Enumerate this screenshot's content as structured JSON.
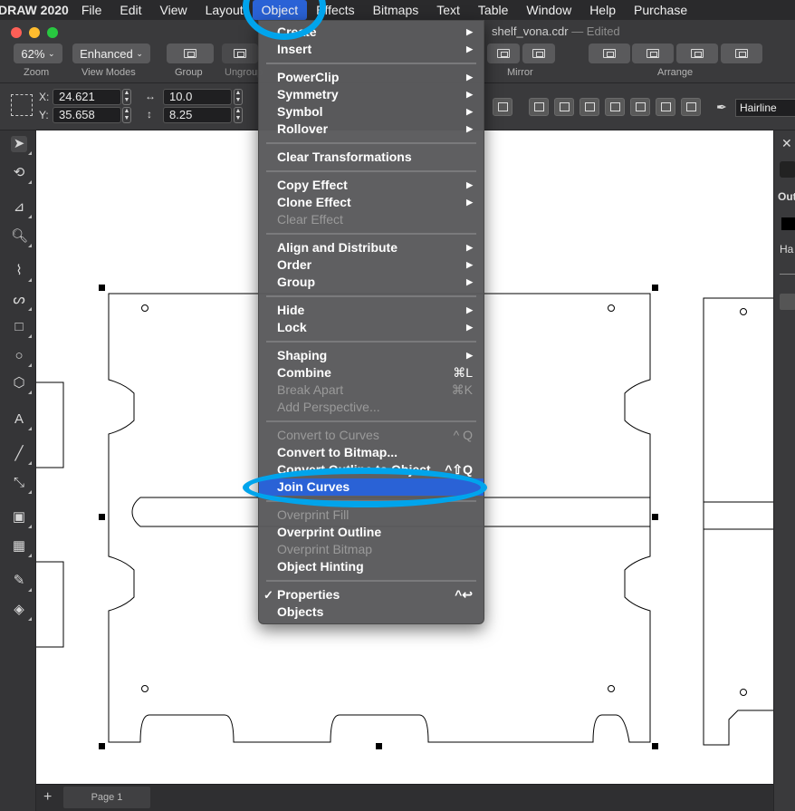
{
  "menubar": {
    "app_title": "DRAW 2020",
    "items": [
      "File",
      "Edit",
      "View",
      "Layout",
      "Object",
      "Effects",
      "Bitmaps",
      "Text",
      "Table",
      "Window",
      "Help",
      "Purchase"
    ],
    "active": "Object"
  },
  "window": {
    "filename": "shelf_vona.cdr",
    "status": "— Edited"
  },
  "toolbar": {
    "zoom_value": "62%",
    "zoom_label": "Zoom",
    "view_mode_value": "Enhanced",
    "view_modes_label": "View Modes",
    "group_label": "Group",
    "ungroup_label": "Ungroup",
    "mirror_label": "Mirror",
    "arrange_label": "Arrange"
  },
  "propertybar": {
    "x_label": "X:",
    "x_value": "24.621",
    "y_label": "Y:",
    "y_value": "35.658",
    "w_value": "10.0",
    "h_value": "8.25",
    "outline_width": "Hairline"
  },
  "docker": {
    "section_label": "Out",
    "field_value": "Ha"
  },
  "status": {
    "add_page": "+",
    "page_tab": "Page 1"
  },
  "object_menu": {
    "items": [
      {
        "label": "Create",
        "submenu": true,
        "disabled": false
      },
      {
        "label": "Insert",
        "submenu": true,
        "disabled": false
      },
      {
        "label": "PowerClip",
        "submenu": true,
        "disabled": false
      },
      {
        "label": "Symmetry",
        "submenu": true,
        "disabled": false
      },
      {
        "label": "Symbol",
        "submenu": true,
        "disabled": false
      },
      {
        "label": "Rollover",
        "submenu": true,
        "disabled": false
      },
      {
        "label": "Clear Transformations",
        "submenu": false,
        "disabled": false
      },
      {
        "label": "Copy Effect",
        "submenu": true,
        "disabled": false
      },
      {
        "label": "Clone Effect",
        "submenu": true,
        "disabled": false
      },
      {
        "label": "Clear Effect",
        "submenu": false,
        "disabled": true
      },
      {
        "label": "Align and Distribute",
        "submenu": true,
        "disabled": false
      },
      {
        "label": "Order",
        "submenu": true,
        "disabled": false
      },
      {
        "label": "Group",
        "submenu": true,
        "disabled": false
      },
      {
        "label": "Hide",
        "submenu": true,
        "disabled": false
      },
      {
        "label": "Lock",
        "submenu": true,
        "disabled": false
      },
      {
        "label": "Shaping",
        "submenu": true,
        "disabled": false
      },
      {
        "label": "Combine",
        "shortcut": "⌘L",
        "disabled": false
      },
      {
        "label": "Break Apart",
        "shortcut": "⌘K",
        "disabled": true
      },
      {
        "label": "Add Perspective...",
        "disabled": true
      },
      {
        "label": "Convert to Curves",
        "shortcut": "^ Q",
        "disabled": true
      },
      {
        "label": "Convert to Bitmap...",
        "disabled": false
      },
      {
        "label": "Convert Outline to Object",
        "shortcut": "^⇧Q",
        "disabled": false
      },
      {
        "label": "Join Curves",
        "disabled": false,
        "highlighted": true
      },
      {
        "label": "Overprint Fill",
        "disabled": true
      },
      {
        "label": "Overprint Outline",
        "disabled": false
      },
      {
        "label": "Overprint Bitmap",
        "disabled": true
      },
      {
        "label": "Object Hinting",
        "disabled": false
      },
      {
        "label": "Properties",
        "shortcut": "^↩",
        "checked": true,
        "disabled": false
      },
      {
        "label": "Objects",
        "disabled": false
      }
    ]
  },
  "colors": {
    "highlight": "#2a62d6",
    "annotation": "#00a4ec"
  }
}
